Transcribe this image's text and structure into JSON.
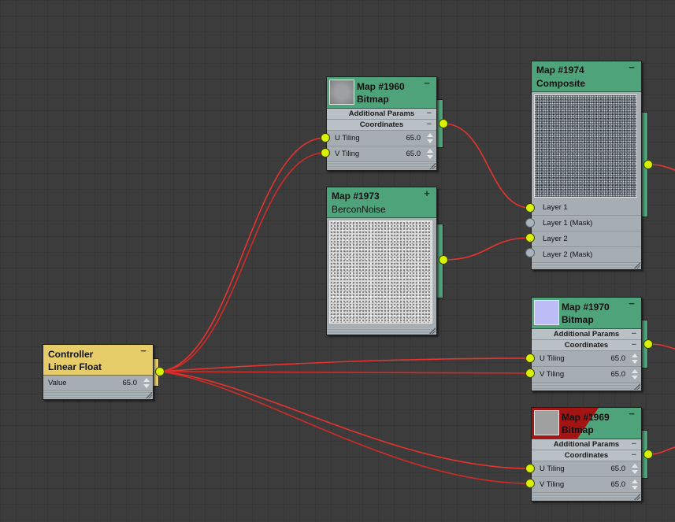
{
  "nodes": {
    "map1960": {
      "id": "Map #1960",
      "type": "Bitmap",
      "sections": [
        "Additional Params",
        "Coordinates"
      ],
      "params": [
        {
          "label": "U Tiling",
          "value": "65.0"
        },
        {
          "label": "V Tiling",
          "value": "65.0"
        }
      ],
      "toggle": "−"
    },
    "map1973": {
      "id": "Map #1973",
      "type": "BerconNoise",
      "toggle": "+"
    },
    "map1974": {
      "id": "Map #1974",
      "type": "Composite",
      "toggle": "−",
      "layers": [
        "Layer 1",
        "Layer 1 (Mask)",
        "Layer 2",
        "Layer 2 (Mask)"
      ]
    },
    "map1970": {
      "id": "Map #1970",
      "type": "Bitmap",
      "sections": [
        "Additional Params",
        "Coordinates"
      ],
      "params": [
        {
          "label": "U Tiling",
          "value": "65.0"
        },
        {
          "label": "V Tiling",
          "value": "65.0"
        }
      ],
      "toggle": "−"
    },
    "map1969": {
      "id": "Map #1969",
      "type": "Bitmap",
      "sections": [
        "Additional Params",
        "Coordinates"
      ],
      "params": [
        {
          "label": "U Tiling",
          "value": "65.0"
        },
        {
          "label": "V Tiling",
          "value": "65.0"
        }
      ],
      "toggle": "−"
    },
    "controller": {
      "title": "Controller",
      "type": "Linear Float",
      "toggle": "−",
      "param": {
        "label": "Value",
        "value": "65.0"
      }
    }
  },
  "colors": {
    "map_header": "#4fa37a",
    "controller_header": "#e6cd6a",
    "wire": "#e8332e",
    "socket_active": "#d8f200",
    "socket_inactive": "#aab3bb",
    "canvas": "#3c3c3c",
    "error_flag": "#a31414"
  }
}
